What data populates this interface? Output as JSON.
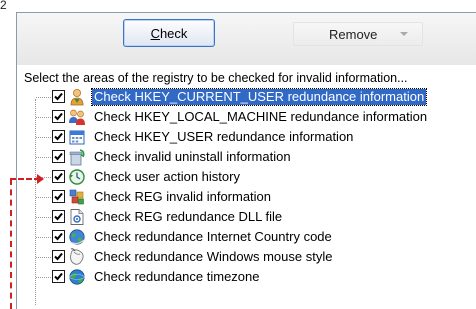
{
  "top_fragment": "2",
  "toolbar": {
    "check_label": "Check",
    "remove_label": "Remove"
  },
  "panel": {
    "instruction": "Select the areas of the registry to be checked for invalid information..."
  },
  "items": [
    {
      "label": "Check HKEY_CURRENT_USER redundance information",
      "icon": "user-icon",
      "checked": true,
      "selected": true
    },
    {
      "label": "Check HKEY_LOCAL_MACHINE redundance information",
      "icon": "users-icon",
      "checked": true,
      "selected": false
    },
    {
      "label": "Check HKEY_USER redundance information",
      "icon": "calendar-icon",
      "checked": true,
      "selected": false
    },
    {
      "label": "Check invalid uninstall information",
      "icon": "uninstall-icon",
      "checked": true,
      "selected": false
    },
    {
      "label": "Check user action history",
      "icon": "history-icon",
      "checked": true,
      "selected": false
    },
    {
      "label": "Check REG invalid information",
      "icon": "registry-icon",
      "checked": true,
      "selected": false
    },
    {
      "label": "Check REG redundance DLL file",
      "icon": "dll-file-icon",
      "checked": true,
      "selected": false
    },
    {
      "label": "Check redundance Internet Country code",
      "icon": "globe-icon",
      "checked": true,
      "selected": false
    },
    {
      "label": "Check redundance Windows mouse style",
      "icon": "mouse-icon",
      "checked": true,
      "selected": false
    },
    {
      "label": "Check redundance timezone",
      "icon": "timezone-globe-icon",
      "checked": true,
      "selected": false
    }
  ],
  "colors": {
    "selection": "#3169c6",
    "annotation": "#d21f1f"
  }
}
